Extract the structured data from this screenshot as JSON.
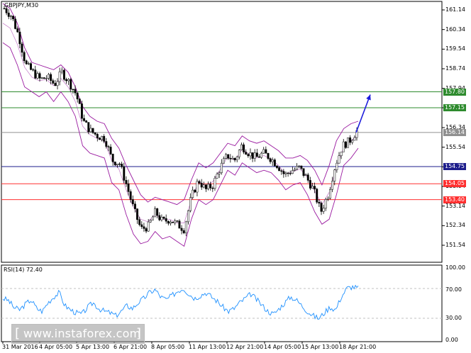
{
  "header": {
    "symbol_label": "GBPJPY,M30"
  },
  "rsi_panel": {
    "label": "RSI(14) 72.40"
  },
  "watermark": {
    "text": "www.instaforex.com"
  },
  "colors": {
    "resistance_green": "#2e8b2e",
    "support_red": "#ff3030",
    "pivot_navy": "#1e1e8c",
    "current_gray": "#909090",
    "bollinger_purple": "#9a1aa0",
    "rsi_blue": "#1e90ff",
    "arrow_blue": "#1c1cdc"
  },
  "chart_data": [
    {
      "type": "candlestick",
      "title": "GBPJPY,M30",
      "y_ticks": [
        "161.14",
        "160.34",
        "159.54",
        "158.74",
        "157.94",
        "157.15",
        "156.34",
        "155.54",
        "154.74",
        "153.94",
        "153.14",
        "152.34",
        "151.54"
      ],
      "x_ticks": [
        "31 Mar 2016",
        "4 Apr 05:00",
        "5 Apr 13:00",
        "6 Apr 21:00",
        "8 Apr 05:00",
        "11 Apr 13:00",
        "12 Apr 21:00",
        "14 Apr 05:00",
        "15 Apr 13:00",
        "18 Apr 21:00"
      ],
      "ylim": [
        151.2,
        161.4
      ],
      "levels": [
        {
          "label": "157.80",
          "value": 157.8,
          "color": "#2e8b2e"
        },
        {
          "label": "157.15",
          "value": 157.15,
          "color": "#2e8b2e"
        },
        {
          "label": "156.14",
          "value": 156.14,
          "color": "#909090"
        },
        {
          "label": "154.75",
          "value": 154.75,
          "color": "#1e1e8c"
        },
        {
          "label": "154.05",
          "value": 154.05,
          "color": "#ff3030"
        },
        {
          "label": "153.40",
          "value": 153.4,
          "color": "#ff3030"
        }
      ],
      "close_path": [
        161.2,
        160.9,
        160.1,
        158.9,
        158.6,
        158.3,
        158.4,
        158.1,
        158.6,
        158.2,
        157.7,
        156.6,
        156.2,
        156.0,
        155.9,
        155.0,
        154.9,
        154.0,
        153.0,
        152.2,
        152.3,
        152.9,
        152.5,
        152.6,
        152.4,
        152.2,
        153.5,
        154.2,
        153.8,
        154.0,
        154.7,
        155.2,
        155.0,
        155.6,
        155.3,
        155.1,
        155.3,
        155.1,
        154.8,
        154.4,
        154.6,
        154.7,
        154.3,
        153.8,
        152.9,
        153.6,
        154.8,
        155.6,
        155.8,
        156.2
      ],
      "upper_band": [
        161.4,
        161.2,
        160.6,
        159.6,
        159.0,
        158.9,
        158.8,
        158.7,
        158.9,
        158.6,
        158.0,
        157.2,
        156.8,
        156.6,
        156.5,
        155.9,
        155.5,
        154.8,
        154.2,
        153.6,
        153.3,
        153.5,
        153.4,
        153.3,
        153.2,
        153.4,
        154.2,
        154.9,
        154.7,
        154.9,
        155.3,
        155.7,
        155.6,
        156.0,
        155.8,
        155.7,
        155.8,
        155.6,
        155.4,
        155.1,
        155.1,
        155.2,
        155.0,
        154.6,
        154.0,
        154.8,
        155.8,
        156.3,
        156.5,
        156.6
      ],
      "lower_band": [
        159.8,
        159.6,
        158.9,
        158.0,
        157.8,
        157.6,
        157.8,
        157.4,
        157.8,
        157.4,
        156.8,
        155.6,
        155.3,
        155.2,
        155.1,
        154.1,
        153.8,
        152.8,
        152.0,
        151.6,
        151.7,
        152.1,
        151.8,
        151.9,
        151.7,
        151.5,
        152.6,
        153.4,
        153.2,
        153.4,
        154.0,
        154.6,
        154.4,
        154.9,
        154.7,
        154.5,
        154.6,
        154.5,
        154.2,
        153.8,
        154.0,
        154.1,
        153.6,
        152.9,
        152.4,
        152.6,
        153.6,
        154.8,
        155.1,
        155.5
      ],
      "forecast_arrow": {
        "from": 156.14,
        "to": 157.8,
        "color": "#1c1cdc"
      }
    },
    {
      "type": "line",
      "title": "RSI(14) 72.40",
      "y_ticks": [
        "100.00",
        "70.00",
        "30.00",
        "0.00"
      ],
      "ylim": [
        0,
        100
      ],
      "series": [
        {
          "values": [
            58,
            55,
            45,
            42,
            50,
            56,
            44,
            40,
            52,
            60,
            66,
            48,
            42,
            38,
            36,
            45,
            52,
            44,
            40,
            38,
            34,
            40,
            48,
            44,
            52,
            58,
            66,
            70,
            60,
            56,
            62,
            68,
            72,
            64,
            58,
            62,
            66,
            60,
            54,
            46,
            40,
            44,
            52,
            58,
            64,
            56,
            48,
            40,
            36,
            44,
            52,
            60,
            56,
            48,
            40,
            34,
            30,
            38,
            46,
            42,
            60,
            72,
            74,
            72
          ]
        }
      ]
    }
  ]
}
